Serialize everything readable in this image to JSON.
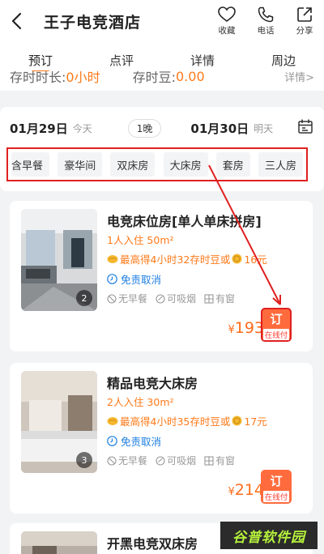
{
  "header": {
    "title": "王子电竞酒店",
    "actions": [
      {
        "label": "收藏",
        "icon": "heart-icon"
      },
      {
        "label": "电话",
        "icon": "phone-icon"
      },
      {
        "label": "分享",
        "icon": "share-icon"
      }
    ]
  },
  "tabs": [
    "预订",
    "点评",
    "详情",
    "周边"
  ],
  "info_strip": {
    "left_label": "存时时长:",
    "left_value": "0小时",
    "mid_label": "存时豆:",
    "mid_value": "0.00",
    "right_link": "详情>"
  },
  "dates": {
    "checkin": "01月29日",
    "checkin_sub": "今天",
    "nights": "1晚",
    "checkout": "01月30日",
    "checkout_sub": "明天"
  },
  "filters": [
    "含早餐",
    "豪华间",
    "双床房",
    "大床房",
    "套房",
    "三人房"
  ],
  "rooms": [
    {
      "name": "电竞床位房[单人单床拼房]",
      "info": "1人入住 50m²",
      "promo": "最高得4小时32存时豆或",
      "promo_value": "16元",
      "cancel": "免责取消",
      "amenities": [
        "无早餐",
        "可吸烟",
        "有窗"
      ],
      "photo_count": "2",
      "price": "193",
      "book_label": "订",
      "book_sub": "在线付"
    },
    {
      "name": "精品电竞大床房",
      "info": "2人入住 30m²",
      "promo": "最高得4小时35存时豆或",
      "promo_value": "17元",
      "cancel": "免责取消",
      "amenities": [
        "无早餐",
        "可吸烟",
        "有窗"
      ],
      "photo_count": "3",
      "price": "214",
      "book_label": "订",
      "book_sub": "在线付"
    },
    {
      "name": "开黑电竞双床房"
    }
  ],
  "currency": "¥",
  "watermark": "谷普软件园",
  "colors": {
    "accent": "#ff7a1a",
    "highlight": "#e02020",
    "link": "#1e7fe0"
  }
}
